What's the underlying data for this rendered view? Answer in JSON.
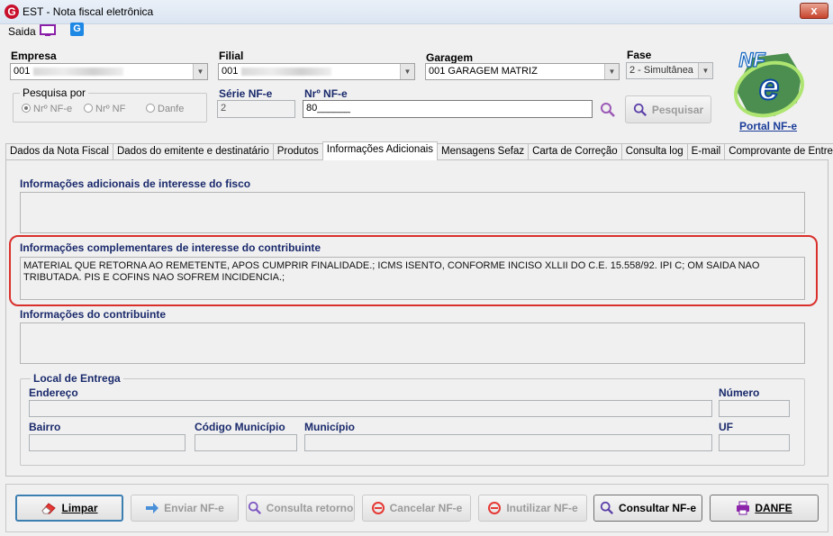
{
  "window": {
    "title": "EST - Nota fiscal eletrônica",
    "close_label": "x"
  },
  "menu": {
    "saida_label": "Saida"
  },
  "header": {
    "empresa_label": "Empresa",
    "empresa_value": "001",
    "filial_label": "Filial",
    "filial_value": "001",
    "garagem_label": "Garagem",
    "garagem_value": "001 GARAGEM MATRIZ",
    "fase_label": "Fase",
    "fase_value": "2 - Simultânea",
    "pesquisa_label": "Pesquisa por",
    "radio_nfe": "Nrº NF-e",
    "radio_nf": "Nrº NF",
    "radio_danfe": "Danfe",
    "serie_label": "Série NF-e",
    "serie_value": "2",
    "nr_label": "Nrº NF-e",
    "nr_value": "80______",
    "pesquisar_label": "Pesquisar",
    "portal_label": "Portal NF-e"
  },
  "tabs": [
    "Dados da Nota Fiscal",
    "Dados do emitente e destinatário",
    "Produtos",
    "Informações Adicionais",
    "Mensagens Sefaz",
    "Carta de Correção",
    "Consulta log",
    "E-mail",
    "Comprovante de Entrega"
  ],
  "info": {
    "fisco_label": "Informações adicionais de interesse do fisco",
    "fisco_value": "",
    "complementares_label": "Informações complementares de interesse do contribuinte",
    "complementares_value": "MATERIAL QUE RETORNA AO REMETENTE, APOS CUMPRIR FINALIDADE.; ICMS ISENTO, CONFORME INCISO  XLLII DO C.E. 15.558/92. IPI C; OM SAIDA NAO TRIBUTADA. PIS E COFINS NAO SOFREM INCIDENCIA.;",
    "contribuinte_label": "Informações do contribuinte",
    "contribuinte_value": ""
  },
  "local_entrega": {
    "title": "Local de Entrega",
    "endereco_label": "Endereço",
    "numero_label": "Número",
    "bairro_label": "Bairro",
    "codigo_municipio_label": "Código Município",
    "municipio_label": "Município",
    "uf_label": "UF"
  },
  "buttons": {
    "limpar": "Limpar",
    "enviar": "Enviar NF-e",
    "consulta_retorno": "Consulta retorno",
    "cancelar": "Cancelar NF-e",
    "inutilizar": "Inutilizar NF-e",
    "consultar": "Consultar NF-e",
    "danfe": "DANFE"
  },
  "colors": {
    "accent": "#1a2a6c",
    "highlight": "#d9302c",
    "title_bar": "#dbe5f2"
  }
}
